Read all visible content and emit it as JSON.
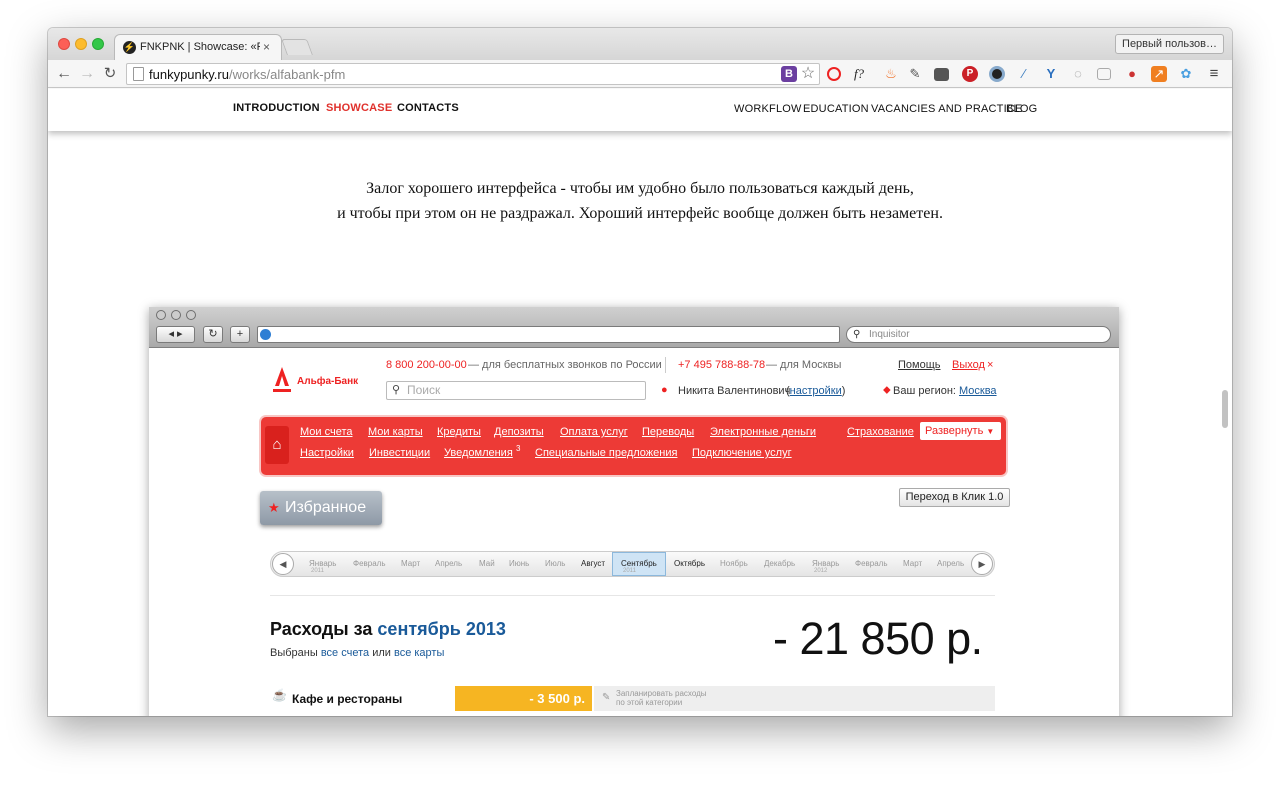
{
  "browser": {
    "tab_title": "FNKPNK | Showcase: «Рас",
    "tab_close": "×",
    "profile_button": "Первый пользов…",
    "url_host": "funkypunky.ru",
    "url_path": "/works/alfabank-pfm",
    "ext_b": "B",
    "ext_star": "☆",
    "ext_f": "f?"
  },
  "site_nav": {
    "left": [
      "INTRODUCTION",
      "SHOWCASE",
      "CONTACTS"
    ],
    "right": [
      "WORKFLOW",
      "EDUCATION",
      "VACANCIES AND PRACTICE",
      "BLOG"
    ]
  },
  "quote": {
    "line1": "Залог хорошего интерфейса - чтобы им удобно было пользоваться каждый день,",
    "line2": "и чтобы при этом он не раздражал. Хороший интерфейс вообще должен быть незаметен."
  },
  "mock_browser": {
    "search_placeholder": "Inquisitor"
  },
  "bank": {
    "logo": "Альфа-Банк",
    "phone_free": "8 800 200-00-00",
    "phone_free_note": "— для бесплатных звонков по России",
    "phone_msk": "+7 495 788-88-78",
    "phone_msk_note": "— для Москвы",
    "help": "Помощь",
    "exit": "Выход",
    "exit_x": "×",
    "search_placeholder": "Поиск",
    "user_name": "Никита Валентинович",
    "settings": "настройки",
    "region_label": "Ваш регион:",
    "region": "Москва",
    "menu_row1": [
      "Мои счета",
      "Мои карты",
      "Кредиты",
      "Депозиты",
      "Оплата услуг",
      "Переводы",
      "Электронные деньги",
      "Страхование"
    ],
    "menu_row2": [
      "Настройки",
      "Инвестиции",
      "Уведомления",
      "Специальные предложения",
      "Подключение услуг"
    ],
    "notifications_count": "3",
    "expand": "Развернуть",
    "expand_arrow": "▼",
    "favorites": "Избранное",
    "klik": "Переход в Клик 1.0",
    "months": [
      "Январь",
      "Февраль",
      "Март",
      "Апрель",
      "Май",
      "Июнь",
      "Июль",
      "Август",
      "Сентябрь",
      "Октябрь",
      "Ноябрь",
      "Декабрь",
      "Январь",
      "Февраль",
      "Март",
      "Апрель"
    ],
    "year_2011": "2011",
    "year_2012": "2012",
    "expenses_prefix": "Расходы за",
    "expenses_period": "сентябрь 2013",
    "selected_prefix": "Выбраны",
    "all_accounts": "все счета",
    "or": "или",
    "all_cards": "все карты",
    "total": "- 21 850 р.",
    "category_name": "Кафе и рестораны",
    "category_amount": "- 3 500 р.",
    "plan_line1": "Запланировать расходы",
    "plan_line2": "по этой категории"
  }
}
